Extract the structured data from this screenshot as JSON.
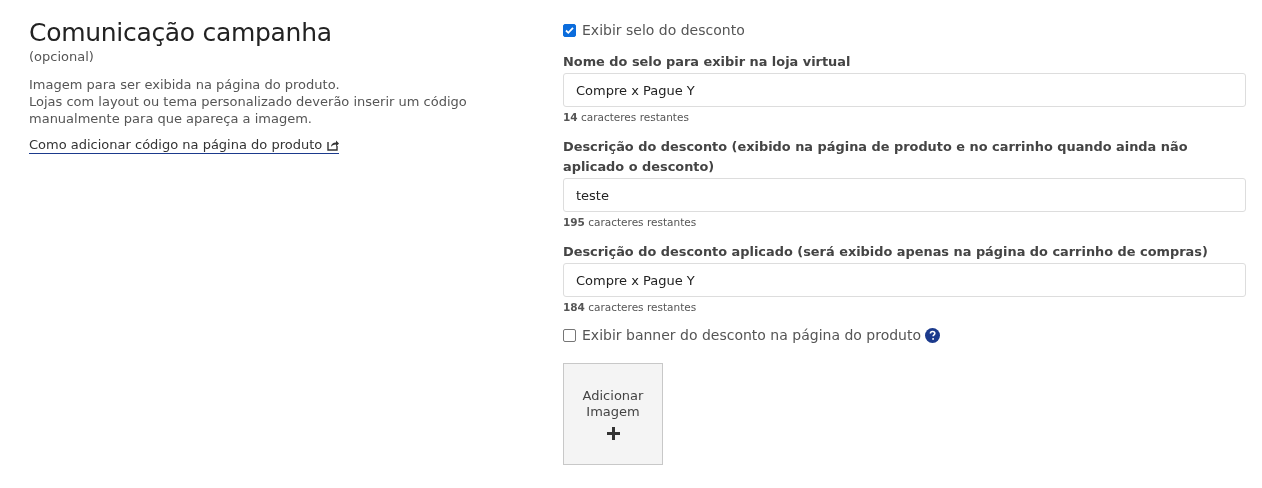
{
  "section": {
    "title": "Comunicação campanha",
    "optional": "(opcional)",
    "description": [
      "Imagem para ser exibida na página do produto.",
      "Lojas com layout ou tema personalizado deverão inserir um código manualmente para que apareça a imagem."
    ],
    "link": "Como adicionar código na página do produto"
  },
  "form": [
    {
      "kind": "checkbox",
      "label": "Exibir selo do desconto",
      "checked": true,
      "help": false
    },
    {
      "kind": "field",
      "label": "Nome do selo para exibir na loja virtual",
      "value": "Compre x Pague Y",
      "counter": "**14** caracteres restantes"
    },
    {
      "kind": "field",
      "label": "Descrição do desconto (exibido na página de produto e no carrinho quando ainda não aplicado o desconto)",
      "value": "teste",
      "counter": "**195** caracteres restantes"
    },
    {
      "kind": "field",
      "label": "Descrição do desconto aplicado (será exibido apenas na página do carrinho de compras)",
      "value": "Compre x Pague Y",
      "counter": "**184** caracteres restantes"
    },
    {
      "kind": "checkbox",
      "label": "Exibir banner do desconto na página do produto",
      "checked": false,
      "help": true
    },
    {
      "kind": "image_button",
      "label": "Adicionar Imagem"
    }
  ]
}
